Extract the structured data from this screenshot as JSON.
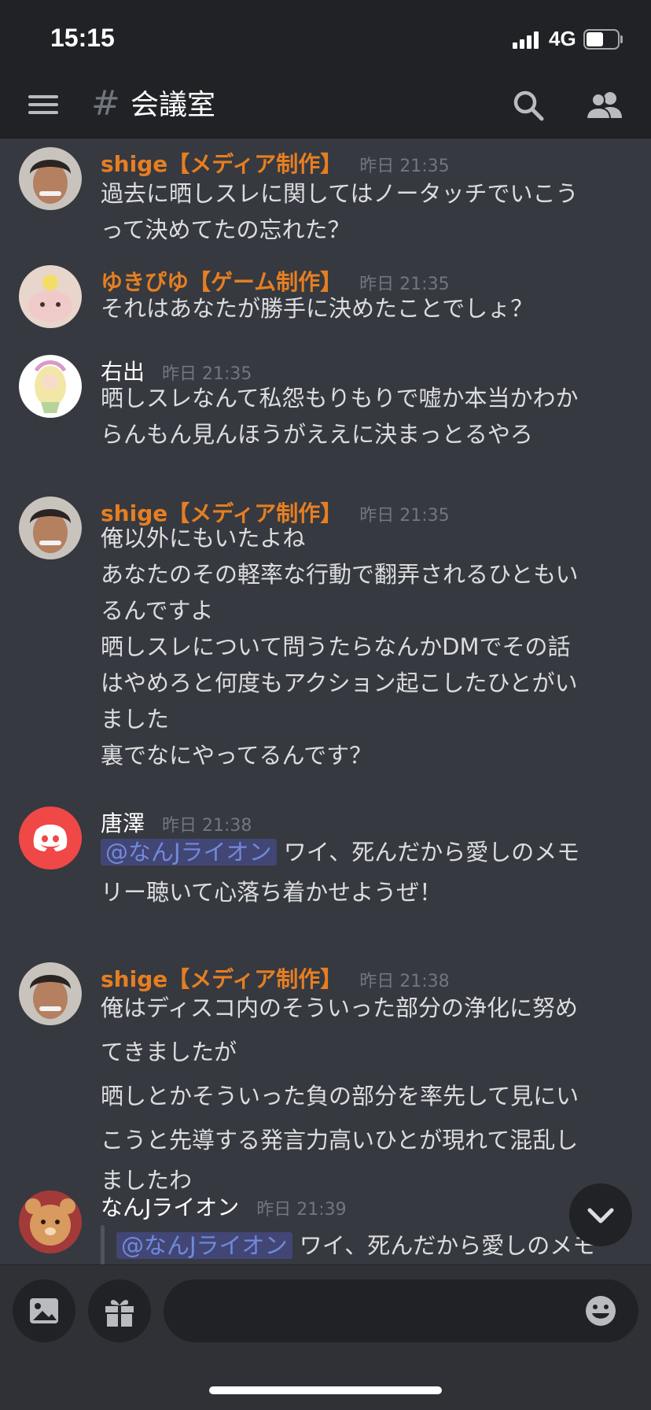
{
  "status_bar": {
    "time": "15:15",
    "network": "4G",
    "battery_level": 0.55
  },
  "header": {
    "channel_hash": "#",
    "channel_name": "会議室",
    "menu_icon": "hamburger-icon",
    "search_icon": "search-icon",
    "members_icon": "members-icon"
  },
  "colors": {
    "background": "#36393f",
    "header": "#202225",
    "role_orange": "#e67e22",
    "mention_bg": "#414675",
    "mention_text": "#7289da",
    "timestamp": "#72767d"
  },
  "messages": [
    {
      "author": "shige【メディア制作】",
      "time": "昨日 21:35",
      "lines": [
        "過去に晒しスレに関してはノータッチでいこう",
        "って決めてたの忘れた？"
      ]
    },
    {
      "author": "ゆきぴゆ【ゲーム制作】",
      "time": "昨日 21:35",
      "lines": [
        "それはあなたが勝手に決めたことでしょ？"
      ]
    },
    {
      "author": "右出",
      "time": "昨日 21:35",
      "lines": [
        "晒しスレなんて私怨もりもりで嘘か本当かわか",
        "らんもん見んほうがええに決まっとるやろ"
      ]
    },
    {
      "author": "shige【メディア制作】",
      "time": "昨日 21:35",
      "lines": [
        "俺以外にもいたよね",
        "あなたのその軽率な行動で翻弄されるひともい",
        "るんですよ",
        "晒しスレについて問うたらなんかDMでその話",
        "はやめろと何度もアクション起こしたひとがい",
        "ました",
        "裏でなにやってるんです？"
      ]
    },
    {
      "author": "唐澤",
      "time": "昨日 21:38",
      "mention": "@なんJライオン",
      "lines": [
        "ワイ、死んだから愛しのメモ",
        "リー聴いて心落ち着かせようぜ！"
      ]
    },
    {
      "author": "shige【メディア制作】",
      "time": "昨日 21:38",
      "lines": [
        "俺はディスコ内のそういった部分の浄化に努め",
        "てきましたが",
        "晒しとかそういった負の部分を率先して見にい",
        "こうと先導する発言力高いひとが現れて混乱し",
        "ましたわ"
      ]
    },
    {
      "author": "なんJライオン",
      "time": "昨日 21:39",
      "mention": "@なんJライオン",
      "lines": [
        "ワイ、死んだから愛しのメモ"
      ]
    }
  ],
  "composer": {
    "image_icon": "image-icon",
    "gift_icon": "gift-icon",
    "emoji_icon": "emoji-icon"
  },
  "scroll_button_icon": "chevron-down-icon"
}
